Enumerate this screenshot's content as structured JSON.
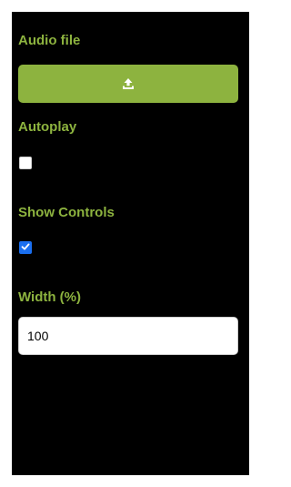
{
  "audio_file": {
    "label": "Audio file",
    "upload_icon": "upload-icon"
  },
  "autoplay": {
    "label": "Autoplay",
    "checked": false
  },
  "show_controls": {
    "label": "Show Controls",
    "checked": true
  },
  "width": {
    "label": "Width (%)",
    "value": "100"
  },
  "colors": {
    "accent": "#8db33f",
    "panel_background": "#000000",
    "checkbox_checked": "#1a6ff0"
  }
}
